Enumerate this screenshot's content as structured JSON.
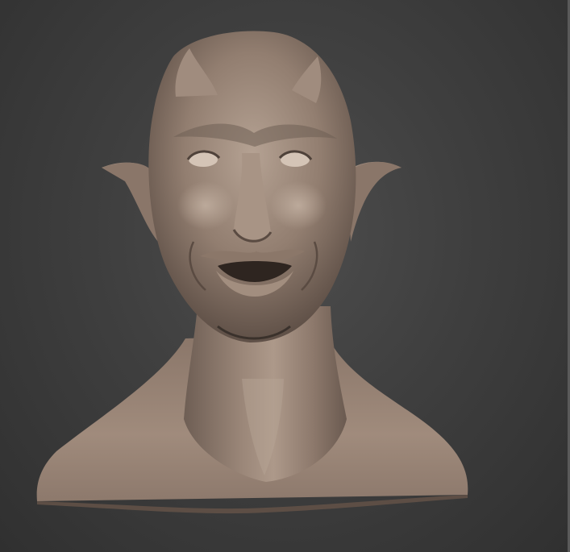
{
  "viewport": {
    "subject": "devil-head-sculpt",
    "colors": {
      "background_center": "#4d4d4d",
      "background_edge": "#303030",
      "clay_light": "#b3a091",
      "clay_mid": "#8f7b6d",
      "clay_dark": "#5e4f46",
      "shadow": "#2a2420"
    }
  }
}
